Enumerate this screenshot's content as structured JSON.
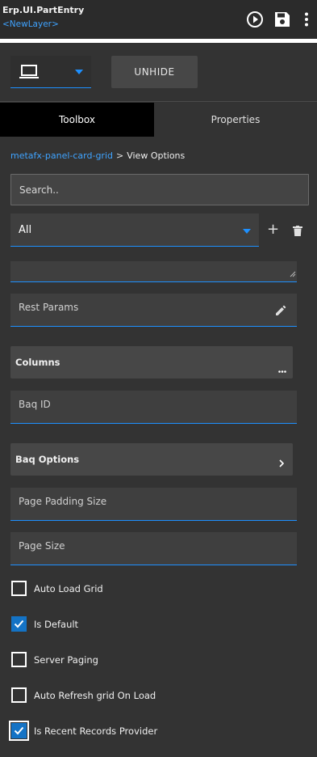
{
  "header": {
    "title": "Erp.UI.PartEntry",
    "layer": "<NewLayer>"
  },
  "toolbar": {
    "device_icon": "laptop-icon",
    "unhide_label": "UNHIDE"
  },
  "tabs": [
    {
      "label": "Toolbox",
      "active": true
    },
    {
      "label": "Properties",
      "active": false
    }
  ],
  "breadcrumb": {
    "parent": "metafx-panel-card-grid",
    "separator": ">",
    "current": "View Options"
  },
  "search": {
    "placeholder": "Search.."
  },
  "filter": {
    "selected": "All"
  },
  "fields": {
    "rest_params": "Rest Params",
    "columns": "Columns",
    "baq_id": "Baq ID",
    "baq_options": "Baq Options",
    "page_padding_size": "Page Padding Size",
    "page_size": "Page Size"
  },
  "checkboxes": [
    {
      "label": "Auto Load Grid",
      "checked": false
    },
    {
      "label": "Is Default",
      "checked": true
    },
    {
      "label": "Server Paging",
      "checked": false
    },
    {
      "label": "Auto Refresh grid On Load",
      "checked": false
    },
    {
      "label": "Is Recent Records Provider",
      "checked": true
    }
  ],
  "colors": {
    "accent": "#1e90ff",
    "link": "#3fa3ff",
    "checkbox_checked": "#1473c5"
  }
}
